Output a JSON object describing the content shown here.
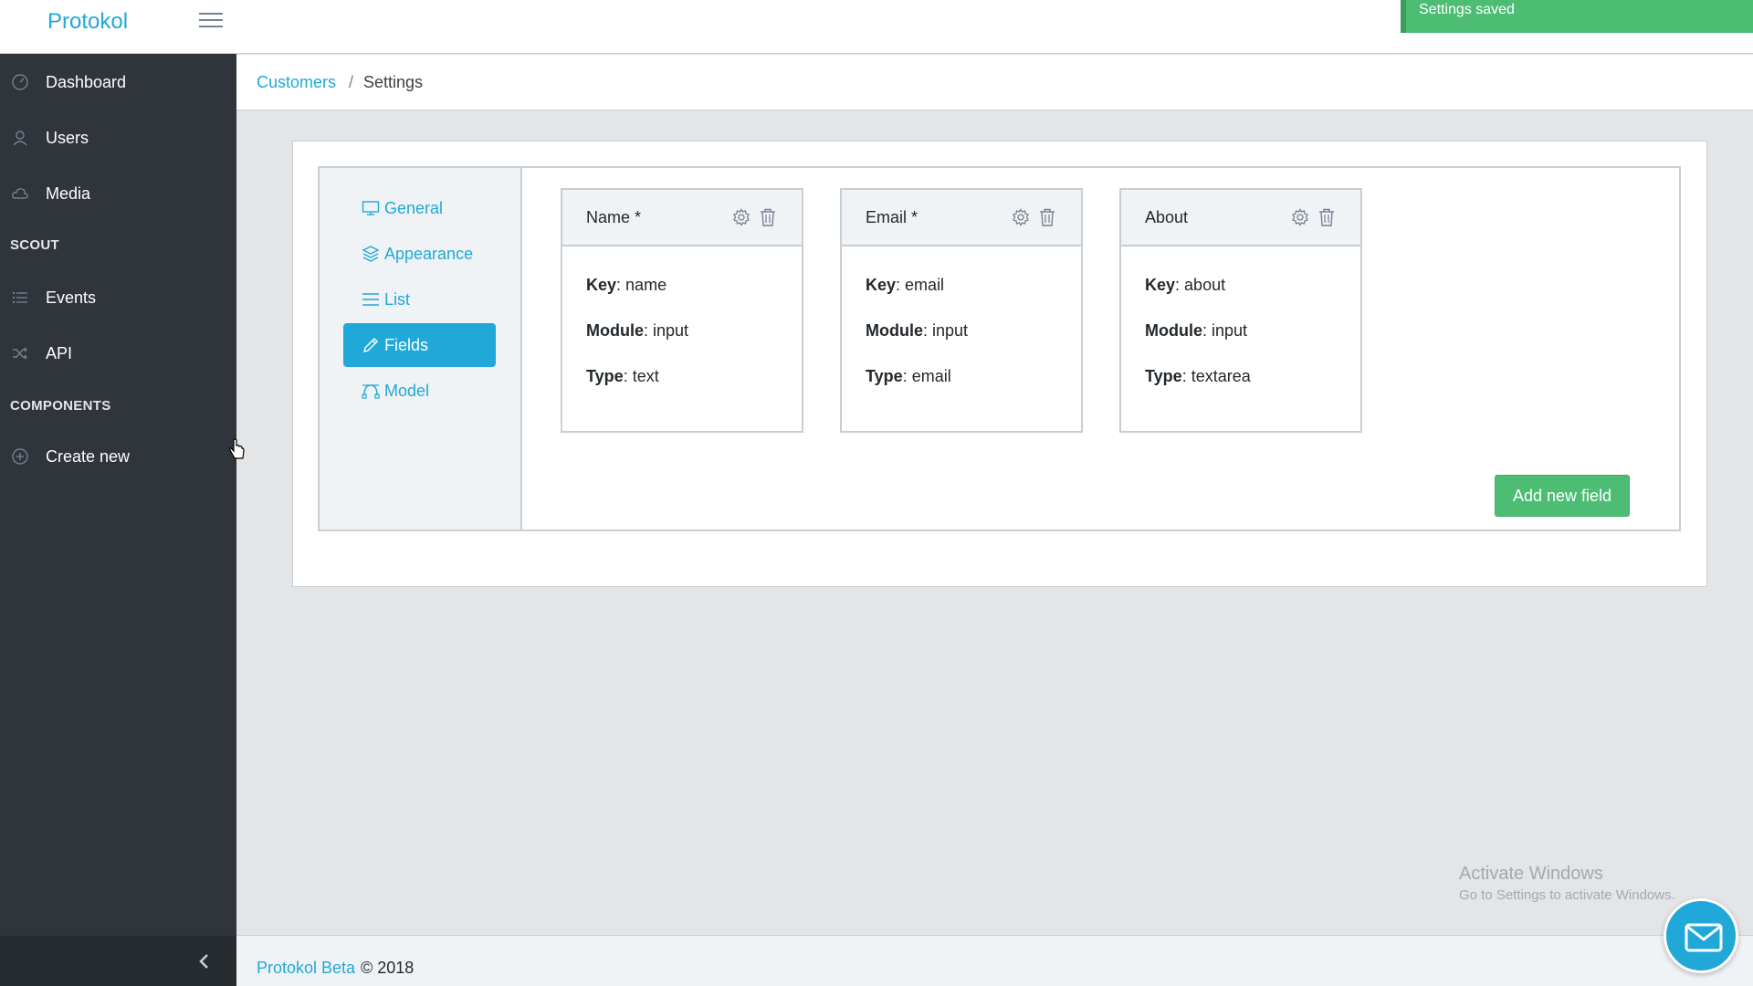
{
  "app": {
    "brand": "Protokol"
  },
  "toast": {
    "message": "Settings saved"
  },
  "sidebar": {
    "items": [
      {
        "label": "Dashboard",
        "icon": "speedometer-icon"
      },
      {
        "label": "Users",
        "icon": "user-icon"
      },
      {
        "label": "Media",
        "icon": "cloud-icon"
      }
    ],
    "section_scout": "SCOUT",
    "scout_items": [
      {
        "label": "Events",
        "icon": "list-icon"
      },
      {
        "label": "API",
        "icon": "shuffle-icon"
      }
    ],
    "section_components": "COMPONENTS",
    "component_items": [
      {
        "label": "Create new",
        "icon": "plus-circle-icon"
      }
    ]
  },
  "breadcrumb": {
    "parent": "Customers",
    "separator": "/",
    "current": "Settings"
  },
  "settings_nav": {
    "items": [
      {
        "label": "General",
        "icon": "monitor-icon"
      },
      {
        "label": "Appearance",
        "icon": "layers-icon"
      },
      {
        "label": "List",
        "icon": "list-icon"
      },
      {
        "label": "Fields",
        "icon": "pencil-icon",
        "active": true
      },
      {
        "label": "Model",
        "icon": "bezier-icon"
      }
    ]
  },
  "fields": {
    "key_label": "Key",
    "module_label": "Module",
    "type_label": "Type",
    "cards": [
      {
        "title": "Name *",
        "key": "name",
        "module": "input",
        "type": "text"
      },
      {
        "title": "Email *",
        "key": "email",
        "module": "input",
        "type": "email"
      },
      {
        "title": "About",
        "key": "about",
        "module": "input",
        "type": "textarea"
      }
    ],
    "add_button": "Add new field"
  },
  "watermark": {
    "line1": "Activate Windows",
    "line2": "Go to Settings to activate Windows."
  },
  "footer": {
    "link": "Protokol Beta",
    "copyright": "© 2018"
  },
  "colors": {
    "primary": "#20a8d8",
    "success": "#4dbd74",
    "sidebar": "#2f353a"
  }
}
